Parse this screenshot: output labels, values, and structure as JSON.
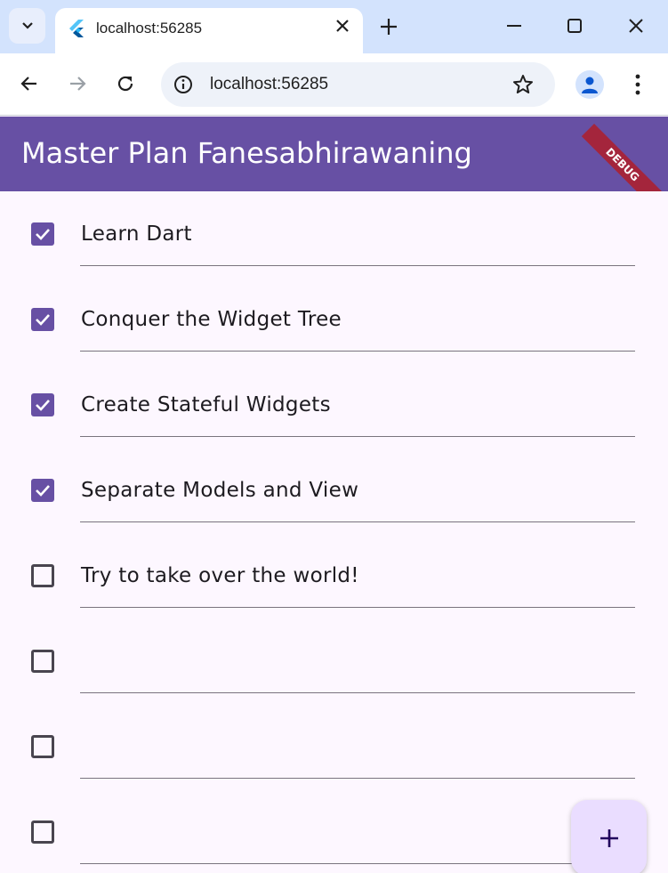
{
  "browser": {
    "tab_title": "localhost:56285",
    "url": "localhost:56285"
  },
  "app": {
    "title": "Master Plan Fanesabhirawaning",
    "debug_label": "DEBUG",
    "accent_color": "#6750a4"
  },
  "tasks": [
    {
      "text": "Learn Dart",
      "done": true
    },
    {
      "text": "Conquer the Widget Tree",
      "done": true
    },
    {
      "text": "Create Stateful Widgets",
      "done": true
    },
    {
      "text": "Separate Models and View",
      "done": true
    },
    {
      "text": "Try to take over the world!",
      "done": false
    },
    {
      "text": "",
      "done": false
    },
    {
      "text": "",
      "done": false
    },
    {
      "text": "",
      "done": false
    }
  ],
  "fab": {
    "icon": "plus-icon"
  }
}
